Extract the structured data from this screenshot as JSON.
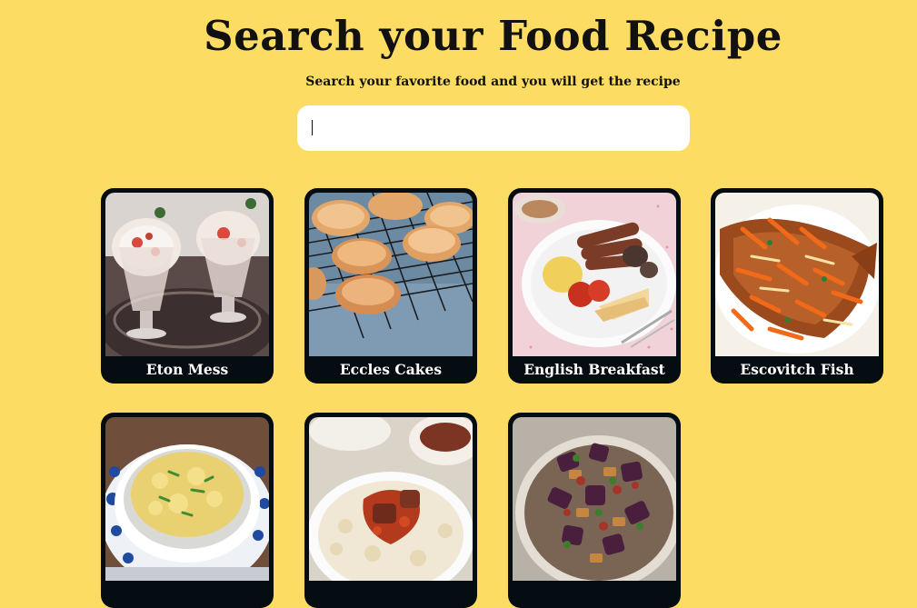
{
  "header": {
    "title": "Search your Food Recipe",
    "subtitle": "Search your favorite food and you will get the recipe"
  },
  "search": {
    "value": "",
    "placeholder": ""
  },
  "recipes": [
    {
      "name": "Eton Mess",
      "icon": "eton-mess-photo"
    },
    {
      "name": "Eccles Cakes",
      "icon": "eccles-cakes-photo"
    },
    {
      "name": "English Breakfast",
      "icon": "english-breakfast-photo"
    },
    {
      "name": "Escovitch Fish",
      "icon": "escovitch-fish-photo"
    },
    {
      "name": "",
      "icon": "soup-photo"
    },
    {
      "name": "",
      "icon": "rice-stew-photo"
    },
    {
      "name": "",
      "icon": "aubergine-dish-photo"
    }
  ],
  "colors": {
    "background": "#fcdc63",
    "card": "#050d12",
    "card_text": "#ffffff"
  }
}
